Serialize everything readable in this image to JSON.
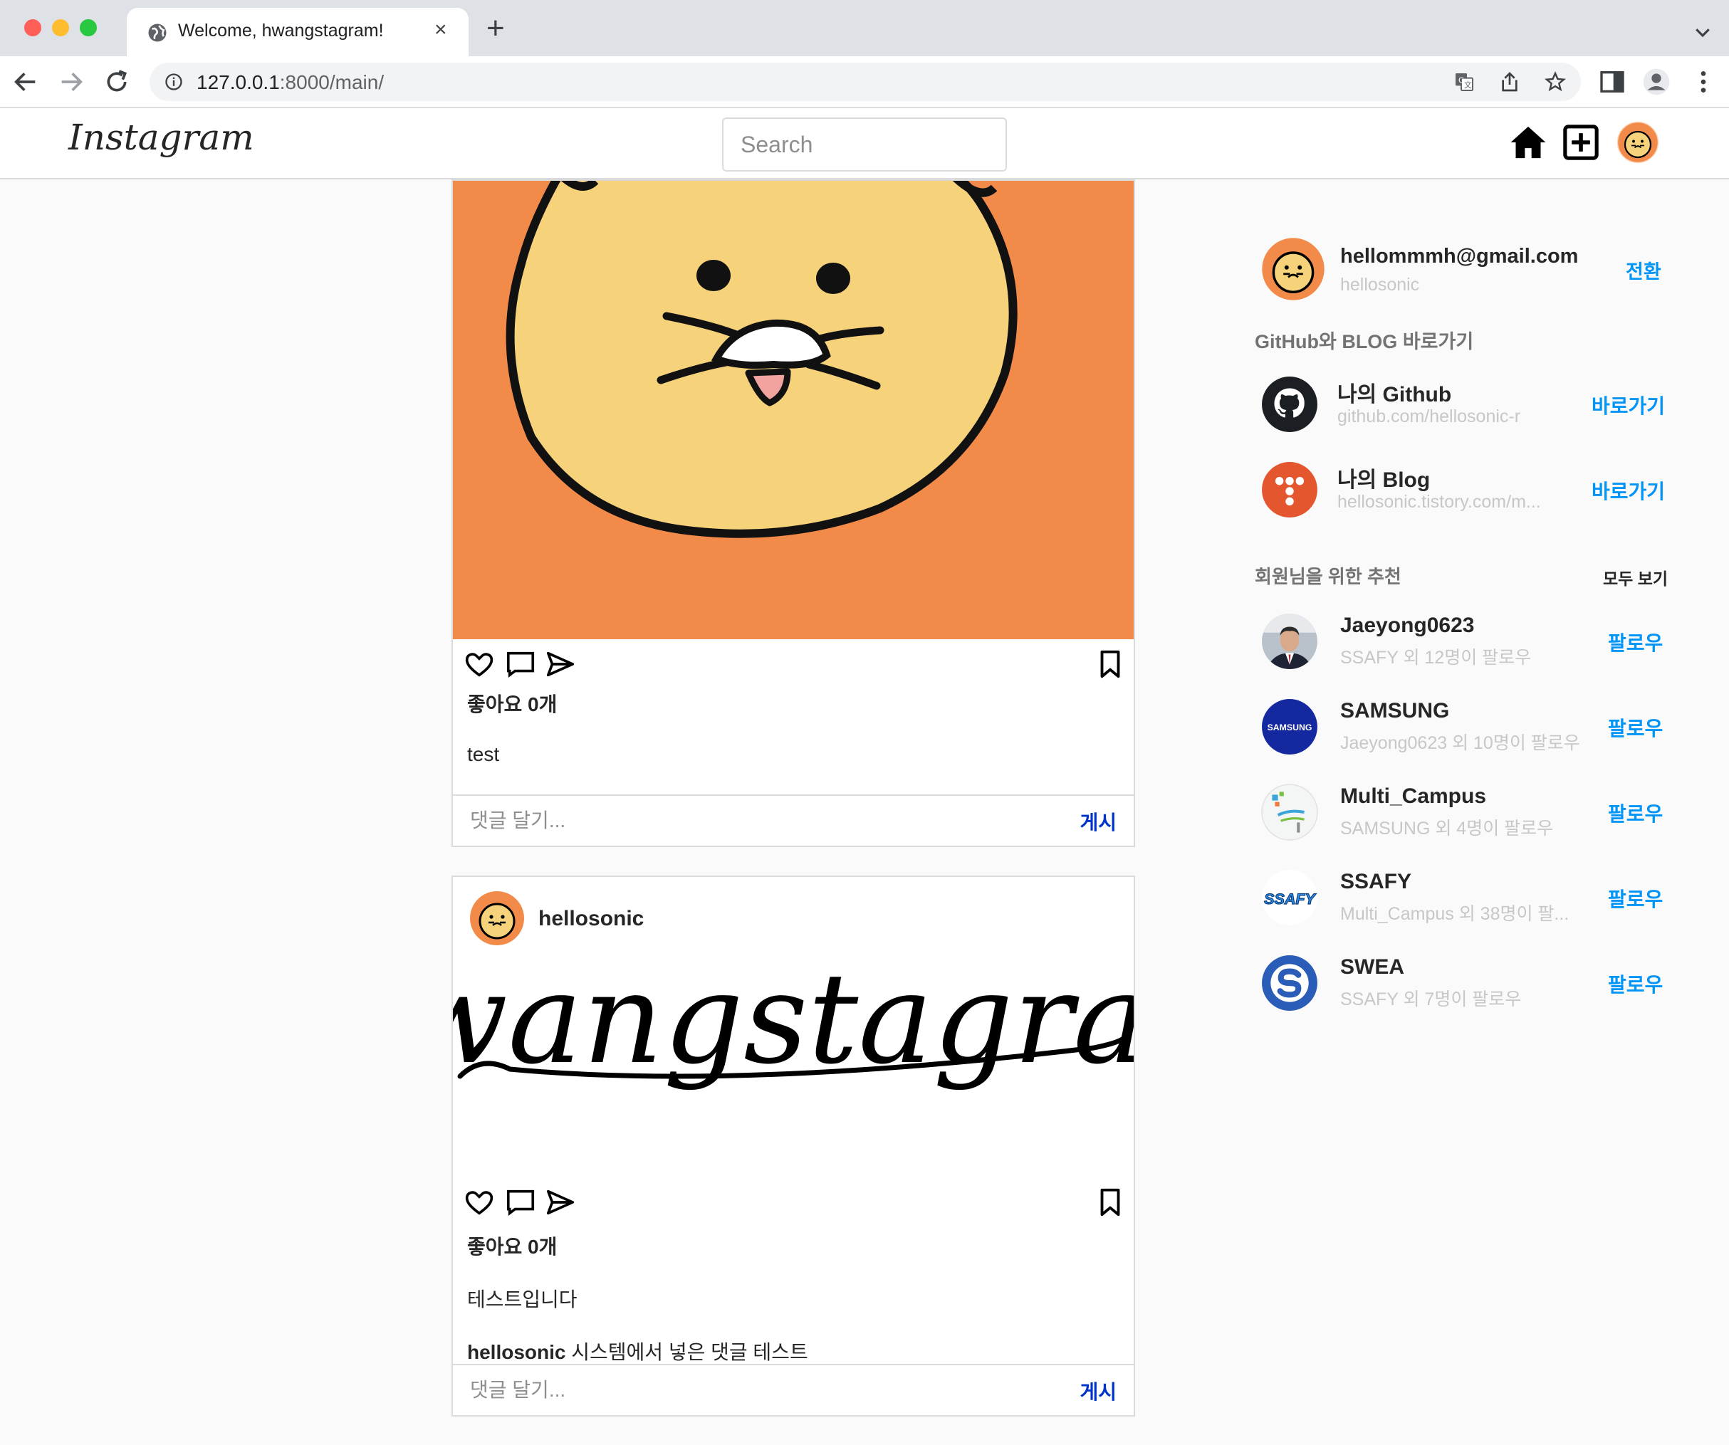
{
  "browser": {
    "tab_title": "Welcome, hwangstagram!",
    "close_glyph": "×",
    "new_tab_glyph": "+",
    "url_host": "127.0.0.1",
    "url_path": ":8000/main/"
  },
  "header": {
    "logo": "Instagram",
    "search_placeholder": "Search"
  },
  "posts": [
    {
      "likes": "좋아요 0개",
      "caption": "test",
      "comment_placeholder": "댓글 달기...",
      "post_label": "게시"
    },
    {
      "username": "hellosonic",
      "image_text": "hwangstagram",
      "likes": "좋아요 0개",
      "caption": "테스트입니다",
      "comment_user": "hellosonic",
      "comment_text": " 시스템에서 넣은 댓글 테스트",
      "comment_placeholder": "댓글 달기...",
      "post_label": "게시"
    }
  ],
  "sidebar": {
    "me": {
      "email": "hellommmh@gmail.com",
      "username": "hellosonic",
      "switch_label": "전환"
    },
    "links_title": "GitHub와 BLOG 바로가기",
    "links": [
      {
        "name": "나의 Github",
        "url": "github.com/hellosonic-r",
        "action": "바로가기"
      },
      {
        "name": "나의 Blog",
        "url": "hellosonic.tistory.com/m...",
        "action": "바로가기"
      }
    ],
    "suggest_title": "회원님을 위한 추천",
    "see_all": "모두 보기",
    "suggestions": [
      {
        "name": "Jaeyong0623",
        "sub": "SSAFY 외 12명이 팔로우",
        "action": "팔로우"
      },
      {
        "name": "SAMSUNG",
        "sub": "Jaeyong0623 외 10명이 팔로우",
        "action": "팔로우",
        "logo_text": "SAMSUNG"
      },
      {
        "name": "Multi_Campus",
        "sub": "SAMSUNG 외 4명이 팔로우",
        "action": "팔로우"
      },
      {
        "name": "SSAFY",
        "sub": "Multi_Campus 외 38명이 팔...",
        "action": "팔로우",
        "logo_text": "SSAFY"
      },
      {
        "name": "SWEA",
        "sub": "SSAFY 외 7명이 팔로우",
        "action": "팔로우"
      }
    ]
  },
  "colors": {
    "brand_orange": "#f28b4a",
    "face_yellow": "#f6d27a",
    "link_blue": "#0095f6",
    "post_blue": "#0033cc"
  }
}
